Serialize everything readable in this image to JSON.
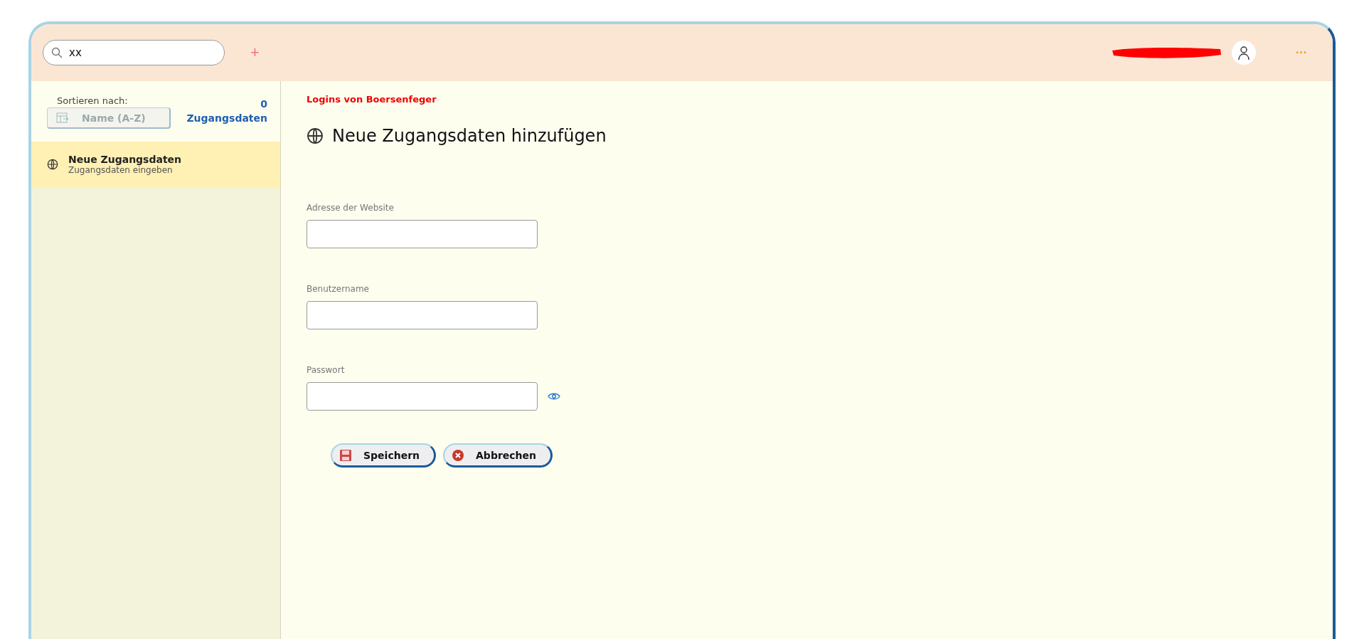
{
  "header": {
    "search": {
      "value": "xx"
    },
    "add_label": "+",
    "more_label": "···"
  },
  "sidebar": {
    "sort_label": "Sortieren nach:",
    "sort": {
      "value": "Name (A-Z)",
      "disabled": true
    },
    "count": "0",
    "count_label": "Zugangsdaten",
    "items": [
      {
        "title": "Neue Zugangsdaten",
        "subtitle": "Zugangsdaten eingeben",
        "selected": true
      }
    ]
  },
  "main": {
    "owner": "Logins von Boersenfeger",
    "title": "Neue Zugangsdaten hinzufügen",
    "fields": [
      {
        "label": "Adresse der Website",
        "kind": "text"
      },
      {
        "label": "Benutzername",
        "kind": "text"
      },
      {
        "label": "Passwort",
        "kind": "password"
      }
    ],
    "buttons": [
      {
        "label": "Speichern",
        "kind": "save"
      },
      {
        "label": "Abbrechen",
        "kind": "cancel"
      }
    ]
  }
}
